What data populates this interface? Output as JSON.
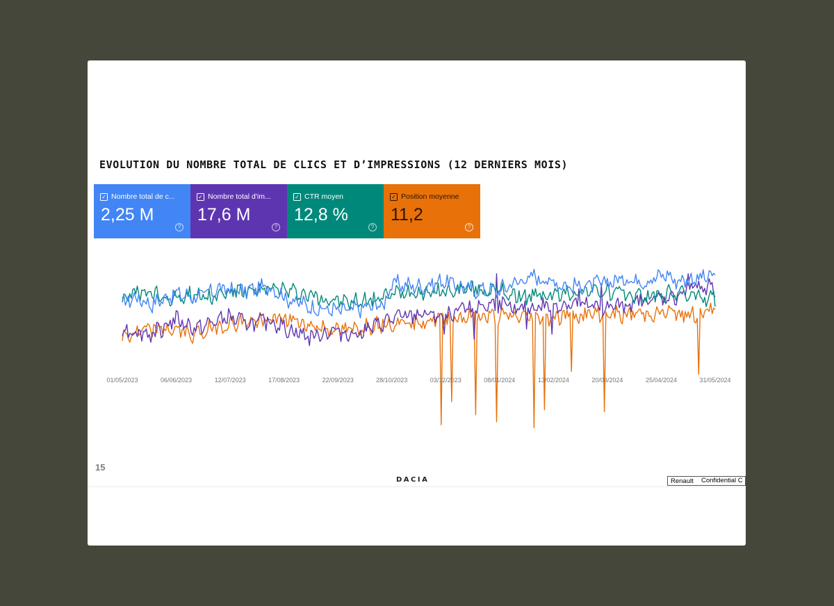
{
  "slide": {
    "title": "EVOLUTION DU NOMBRE TOTAL DE CLICS ET D’IMPRESSIONS (12 DERNIERS MOIS)",
    "page_number": "15",
    "logo_text": "DACIA",
    "footer_brand": "Renault",
    "footer_classification": "Confidential C"
  },
  "metrics": [
    {
      "label": "Nombre total de c...",
      "value": "2,25 M",
      "color": "#4285f4"
    },
    {
      "label": "Nombre total d'im...",
      "value": "17,6 M",
      "color": "#5e35b1"
    },
    {
      "label": "CTR moyen",
      "value": "12,8 %",
      "color": "#00897b"
    },
    {
      "label": "Position moyenne",
      "value": "11,2",
      "color": "#e8710a"
    }
  ],
  "chart_data": {
    "type": "line",
    "x_ticks": [
      "01/05/2023",
      "06/06/2023",
      "12/07/2023",
      "17/08/2023",
      "22/09/2023",
      "28/10/2023",
      "03/12/2023",
      "08/01/2024",
      "13/02/2024",
      "20/03/2024",
      "25/04/2024",
      "31/05/2024"
    ],
    "x_range": [
      "01/05/2023",
      "31/05/2024"
    ],
    "y_axis_visible": false,
    "grid": false,
    "legend": "metric tiles above chart",
    "series": [
      {
        "name": "Nombre total de clics",
        "color": "#4285f4",
        "anchors": [
          [
            0,
            0.55
          ],
          [
            8,
            0.62
          ],
          [
            20,
            0.55
          ],
          [
            35,
            0.65
          ],
          [
            50,
            0.62
          ],
          [
            65,
            0.7
          ],
          [
            80,
            0.68
          ],
          [
            100,
            0.72
          ],
          [
            110,
            0.6
          ],
          [
            130,
            0.5
          ],
          [
            150,
            0.48
          ],
          [
            175,
            0.55
          ],
          [
            180,
            0.75
          ],
          [
            200,
            0.72
          ],
          [
            215,
            0.78
          ],
          [
            230,
            0.7
          ],
          [
            250,
            0.68
          ],
          [
            265,
            0.78
          ],
          [
            275,
            0.82
          ],
          [
            300,
            0.72
          ],
          [
            320,
            0.75
          ],
          [
            335,
            0.8
          ],
          [
            350,
            0.78
          ],
          [
            365,
            0.85
          ],
          [
            368,
            0.78
          ],
          [
            396,
            0.82
          ]
        ],
        "spikes": []
      },
      {
        "name": "Nombre total d'impressions",
        "color": "#5e35b1",
        "anchors": [
          [
            0,
            0.3
          ],
          [
            20,
            0.25
          ],
          [
            35,
            0.4
          ],
          [
            50,
            0.3
          ],
          [
            70,
            0.42
          ],
          [
            85,
            0.35
          ],
          [
            100,
            0.38
          ],
          [
            110,
            0.3
          ],
          [
            125,
            0.22
          ],
          [
            140,
            0.28
          ],
          [
            150,
            0.25
          ],
          [
            165,
            0.3
          ],
          [
            180,
            0.4
          ],
          [
            200,
            0.45
          ],
          [
            215,
            0.42
          ],
          [
            230,
            0.5
          ],
          [
            250,
            0.55
          ],
          [
            265,
            0.48
          ],
          [
            275,
            0.52
          ],
          [
            300,
            0.55
          ],
          [
            320,
            0.5
          ],
          [
            340,
            0.55
          ],
          [
            355,
            0.6
          ],
          [
            370,
            0.62
          ],
          [
            385,
            0.75
          ],
          [
            396,
            0.65
          ]
        ],
        "spikes": [
          [
            215,
            0.25
          ],
          [
            235,
            0.2
          ],
          [
            250,
            0.85
          ],
          [
            270,
            0.3
          ],
          [
            287,
            0.25
          ],
          [
            305,
            0.7
          ],
          [
            320,
            0.75
          ],
          [
            378,
            0.85
          ],
          [
            392,
            0.8
          ]
        ]
      },
      {
        "name": "CTR moyen",
        "color": "#00897b",
        "anchors": [
          [
            0,
            0.62
          ],
          [
            15,
            0.66
          ],
          [
            30,
            0.6
          ],
          [
            45,
            0.65
          ],
          [
            60,
            0.62
          ],
          [
            75,
            0.68
          ],
          [
            90,
            0.65
          ],
          [
            100,
            0.72
          ],
          [
            110,
            0.68
          ],
          [
            130,
            0.62
          ],
          [
            150,
            0.56
          ],
          [
            170,
            0.6
          ],
          [
            190,
            0.68
          ],
          [
            210,
            0.66
          ],
          [
            230,
            0.7
          ],
          [
            250,
            0.68
          ],
          [
            270,
            0.62
          ],
          [
            290,
            0.64
          ],
          [
            310,
            0.68
          ],
          [
            330,
            0.65
          ],
          [
            350,
            0.62
          ],
          [
            370,
            0.66
          ],
          [
            385,
            0.62
          ],
          [
            396,
            0.6
          ]
        ],
        "spikes": []
      },
      {
        "name": "Position moyenne",
        "color": "#e8710a",
        "anchors": [
          [
            0,
            0.22
          ],
          [
            15,
            0.28
          ],
          [
            30,
            0.3
          ],
          [
            50,
            0.25
          ],
          [
            70,
            0.35
          ],
          [
            90,
            0.38
          ],
          [
            110,
            0.4
          ],
          [
            130,
            0.32
          ],
          [
            150,
            0.28
          ],
          [
            170,
            0.35
          ],
          [
            190,
            0.38
          ],
          [
            210,
            0.4
          ],
          [
            230,
            0.42
          ],
          [
            250,
            0.42
          ],
          [
            270,
            0.42
          ],
          [
            290,
            0.42
          ],
          [
            310,
            0.44
          ],
          [
            330,
            0.45
          ],
          [
            350,
            0.45
          ],
          [
            370,
            0.46
          ],
          [
            380,
            0.44
          ],
          [
            396,
            0.48
          ]
        ],
        "spikes": [
          [
            213,
            -0.65
          ],
          [
            220,
            -0.42
          ],
          [
            236,
            -0.55
          ],
          [
            250,
            -0.62
          ],
          [
            275,
            -0.68
          ],
          [
            282,
            -0.5
          ],
          [
            300,
            -0.12
          ],
          [
            322,
            -0.52
          ],
          [
            385,
            -0.15
          ]
        ]
      }
    ]
  }
}
